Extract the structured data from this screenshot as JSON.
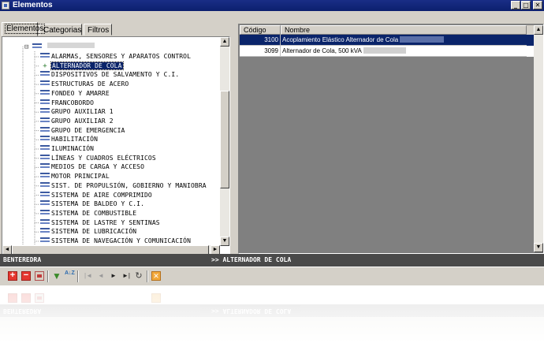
{
  "window": {
    "title": "Elementos",
    "min_glyph": "_",
    "max_glyph": "□",
    "close_glyph": "✕"
  },
  "tabs": [
    {
      "label": "Elementos",
      "active": true
    },
    {
      "label": "Categorias",
      "active": false
    },
    {
      "label": "Filtros",
      "active": false
    }
  ],
  "tree": {
    "root_expander": "⊟",
    "items": [
      {
        "label": "ALARMAS, SENSORES Y APARATOS CONTROL",
        "selected": false,
        "type": "folder"
      },
      {
        "label": "ALTERNADOR DE COLA",
        "selected": true,
        "type": "leaf"
      },
      {
        "label": "DISPOSITIVOS DE SALVAMENTO Y C.I.",
        "selected": false,
        "type": "folder"
      },
      {
        "label": "ESTRUCTURAS DE ACERO",
        "selected": false,
        "type": "folder"
      },
      {
        "label": "FONDEO Y AMARRE",
        "selected": false,
        "type": "folder"
      },
      {
        "label": "FRANCOBORDO",
        "selected": false,
        "type": "folder"
      },
      {
        "label": "GRUPO AUXILIAR 1",
        "selected": false,
        "type": "folder"
      },
      {
        "label": "GRUPO AUXILIAR 2",
        "selected": false,
        "type": "folder"
      },
      {
        "label": "GRUPO DE EMERGENCIA",
        "selected": false,
        "type": "folder"
      },
      {
        "label": "HABILITACIÓN",
        "selected": false,
        "type": "folder"
      },
      {
        "label": "ILUMINACIÓN",
        "selected": false,
        "type": "folder"
      },
      {
        "label": "LÍNEAS Y CUADROS ELÉCTRICOS",
        "selected": false,
        "type": "folder"
      },
      {
        "label": "MEDIOS DE CARGA Y ACCESO",
        "selected": false,
        "type": "folder"
      },
      {
        "label": "MOTOR PRINCIPAL",
        "selected": false,
        "type": "folder"
      },
      {
        "label": "SIST. DE PROPULSIÓN, GOBIERNO Y MANIOBRA",
        "selected": false,
        "type": "folder"
      },
      {
        "label": "SISTEMA DE AIRE COMPRIMIDO",
        "selected": false,
        "type": "folder"
      },
      {
        "label": "SISTEMA DE BALDEO Y C.I.",
        "selected": false,
        "type": "folder"
      },
      {
        "label": "SISTEMA DE COMBUSTIBLE",
        "selected": false,
        "type": "folder"
      },
      {
        "label": "SISTEMA DE LASTRE Y SENTINAS",
        "selected": false,
        "type": "folder"
      },
      {
        "label": "SISTEMA DE LUBRICACIÓN",
        "selected": false,
        "type": "folder"
      },
      {
        "label": "SISTEMA DE NAVEGACIÓN Y COMUNICACIÓN",
        "selected": false,
        "type": "folder"
      }
    ]
  },
  "scroll": {
    "up": "▲",
    "down": "▼",
    "left": "◄",
    "right": "►"
  },
  "grid": {
    "columns": [
      "Código",
      "Nombre"
    ],
    "rows": [
      {
        "code": "3100",
        "name": "Acoplamiento Elástico Alternador de Cola",
        "selected": true
      },
      {
        "code": "3099",
        "name": "Alternador de Cola, 500 kVA",
        "selected": false
      }
    ]
  },
  "status": {
    "left": "BENTEREDRA",
    "right": ">> ALTERNADOR DE COLA"
  },
  "toolbar": {
    "add": "+",
    "delete": "−",
    "filter": "▼",
    "sort": "A↓Z",
    "first": "|◄",
    "prev": "◄",
    "next": "►",
    "last": "►|",
    "refresh": "↻",
    "exit": "✕"
  },
  "colors": {
    "titlebar": "#0b1f6e",
    "selection": "#0a246a",
    "status_bg": "#4a4a4a",
    "window_bg": "#d4d0c8"
  }
}
